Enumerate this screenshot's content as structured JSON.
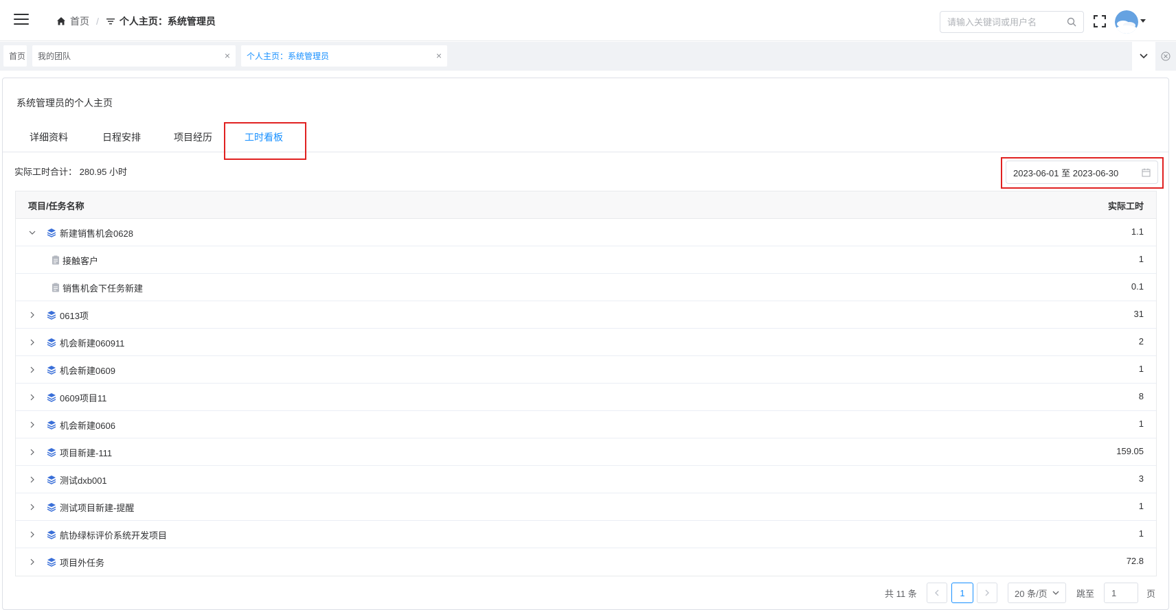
{
  "header": {
    "breadcrumb_home": "首页",
    "breadcrumb_separator": "/",
    "breadcrumb_current": "个人主页：系统管理员",
    "search_placeholder": "请输入关键词或用户名"
  },
  "tags": [
    {
      "label": "首页"
    },
    {
      "label": "我的团队",
      "close": "×"
    },
    {
      "label": "个人主页：系统管理员",
      "close": "×",
      "active": true
    }
  ],
  "page": {
    "title": "系统管理员的个人主页",
    "tabs": [
      {
        "label": "详细资料"
      },
      {
        "label": "日程安排"
      },
      {
        "label": "项目经历"
      },
      {
        "label": "工时看板",
        "active": true
      }
    ],
    "summary": "实际工时合计： 280.95 小时",
    "date_range": "2023-06-01 至 2023-06-30"
  },
  "table": {
    "columns": [
      "项目/任务名称",
      "实际工时"
    ],
    "rows": [
      {
        "name": "新建销售机会0628",
        "hours": "1.1",
        "level": 0,
        "expanded": true,
        "icon": "layers-icon"
      },
      {
        "name": "接触客户",
        "hours": "1",
        "level": 1,
        "icon": "task-icon"
      },
      {
        "name": "销售机会下任务新建",
        "hours": "0.1",
        "level": 1,
        "icon": "task-icon"
      },
      {
        "name": "0613项",
        "hours": "31",
        "level": 0,
        "icon": "layers-icon"
      },
      {
        "name": "机会新建060911",
        "hours": "2",
        "level": 0,
        "icon": "layers-icon"
      },
      {
        "name": "机会新建0609",
        "hours": "1",
        "level": 0,
        "icon": "layers-icon"
      },
      {
        "name": "0609项目11",
        "hours": "8",
        "level": 0,
        "icon": "layers-icon"
      },
      {
        "name": "机会新建0606",
        "hours": "1",
        "level": 0,
        "icon": "layers-icon"
      },
      {
        "name": "项目新建-111",
        "hours": "159.05",
        "level": 0,
        "icon": "layers-icon"
      },
      {
        "name": "测试dxb001",
        "hours": "3",
        "level": 0,
        "icon": "layers-icon"
      },
      {
        "name": "测试项目新建-提醒",
        "hours": "1",
        "level": 0,
        "icon": "layers-icon"
      },
      {
        "name": "航协绿标评价系统开发项目",
        "hours": "1",
        "level": 0,
        "icon": "layers-icon"
      },
      {
        "name": "项目外任务",
        "hours": "72.8",
        "level": 0,
        "icon": "layers-icon"
      }
    ]
  },
  "pagination": {
    "total": "共 11 条",
    "current_page": "1",
    "page_size": "20 条/页",
    "jump_label": "跳至",
    "jump_value": "1",
    "page_unit": "页"
  },
  "colors": {
    "accent": "#1890ff",
    "highlight": "#e02020",
    "icon_blue": "#3a6fd8"
  }
}
